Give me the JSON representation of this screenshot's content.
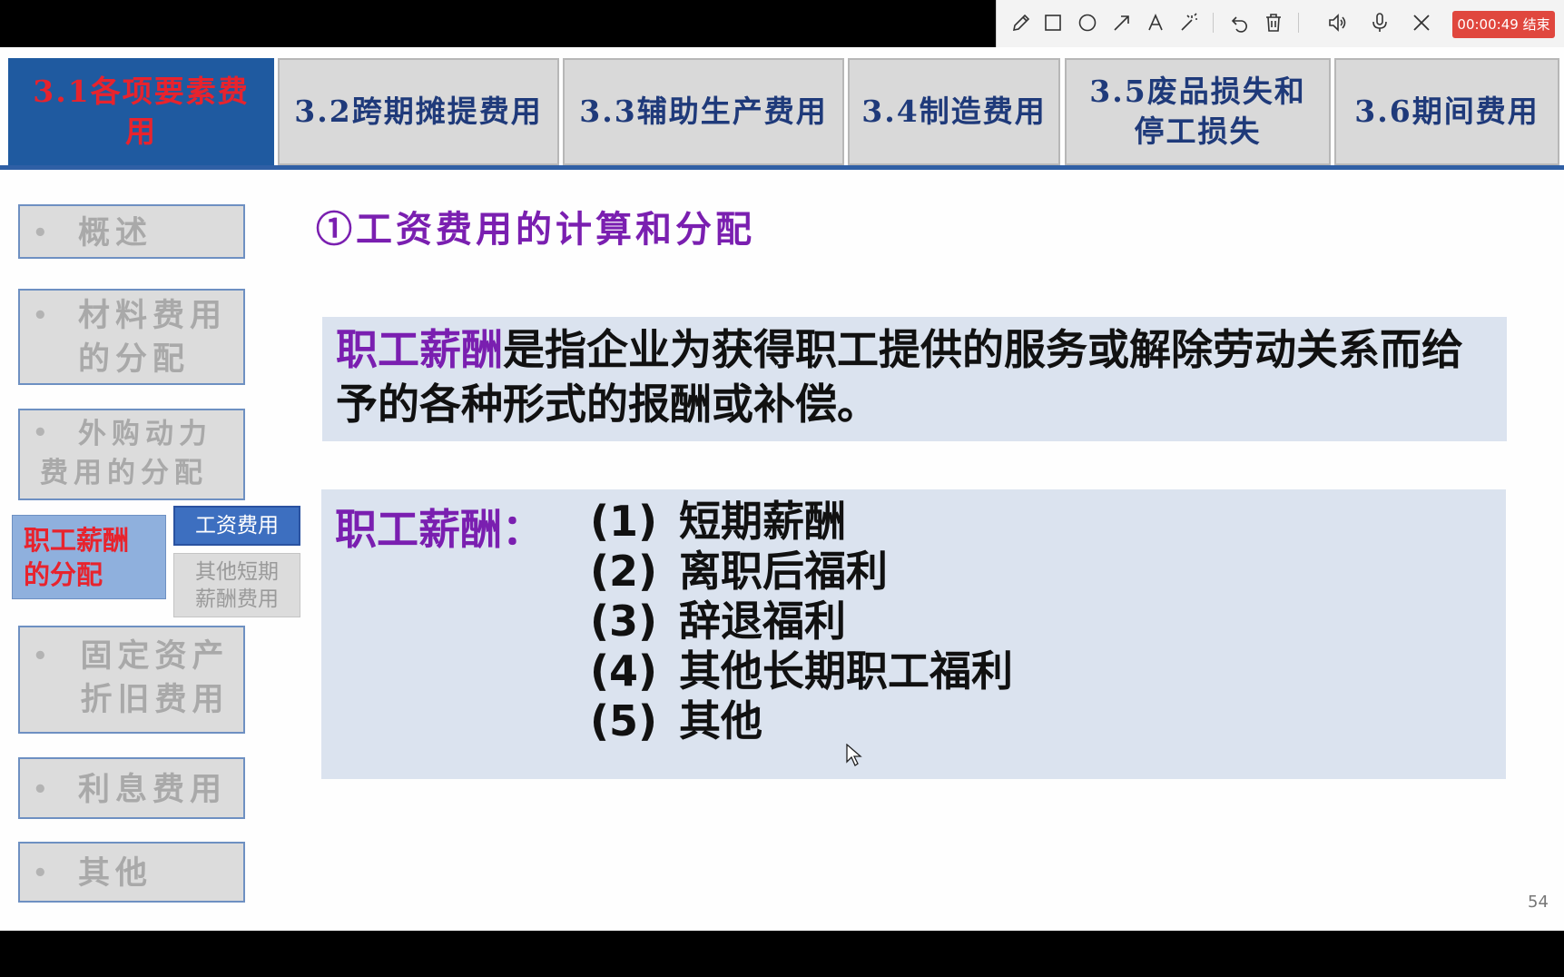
{
  "recorder": {
    "tools": [
      "pen-icon",
      "rectangle-icon",
      "ellipse-icon",
      "arrow-icon",
      "text-icon",
      "magic-wand-icon",
      "undo-icon",
      "trash-icon",
      "speaker-icon",
      "microphone-icon",
      "close-icon"
    ],
    "timer": "00:00:49",
    "end_label": "结束",
    "accent": "#e0473e"
  },
  "tabs": [
    {
      "label": "3.1各项要素费用"
    },
    {
      "label": "3.2跨期摊提费用"
    },
    {
      "label": "3.3辅助生产费用"
    },
    {
      "label": "3.4制造费用"
    },
    {
      "label": "3.5废品损失和停工损失"
    },
    {
      "label": "3.6期间费用"
    }
  ],
  "sidebar": {
    "items": [
      {
        "bullet": "•",
        "label": "概述"
      },
      {
        "bullet": "•",
        "label": "材料费用的分配"
      },
      {
        "bullet": "•",
        "label": "外购动力费用的分配"
      },
      {
        "label": "职工薪酬的分配"
      },
      {
        "bullet": "•",
        "label": "固定资产折旧费用"
      },
      {
        "bullet": "•",
        "label": "利息费用"
      },
      {
        "bullet": "•",
        "label": "其他"
      }
    ],
    "sub_items": [
      {
        "label": "工资费用"
      },
      {
        "label": "其他短期薪酬费用"
      }
    ]
  },
  "content": {
    "heading": "①工资费用的计算和分配",
    "definition_term": "职工薪酬",
    "definition_body": "是指企业为获得职工提供的服务或解除劳动关系而给予的各种形式的报酬或补偿。",
    "list_label": "职工薪酬：",
    "list": [
      {
        "num": "(1)",
        "text": "短期薪酬"
      },
      {
        "num": "(2)",
        "text": "离职后福利"
      },
      {
        "num": "(3)",
        "text": "辞退福利"
      },
      {
        "num": "(4)",
        "text": "其他长期职工福利"
      },
      {
        "num": "(5)",
        "text": "其他"
      }
    ]
  },
  "page_number": "54",
  "colors": {
    "tab_active_bg": "#1f5aa0",
    "tab_active_text": "#e8232d",
    "tab_text": "#1f3a7a",
    "heading": "#7a1fb0",
    "content_box": "#dbe3ef"
  }
}
